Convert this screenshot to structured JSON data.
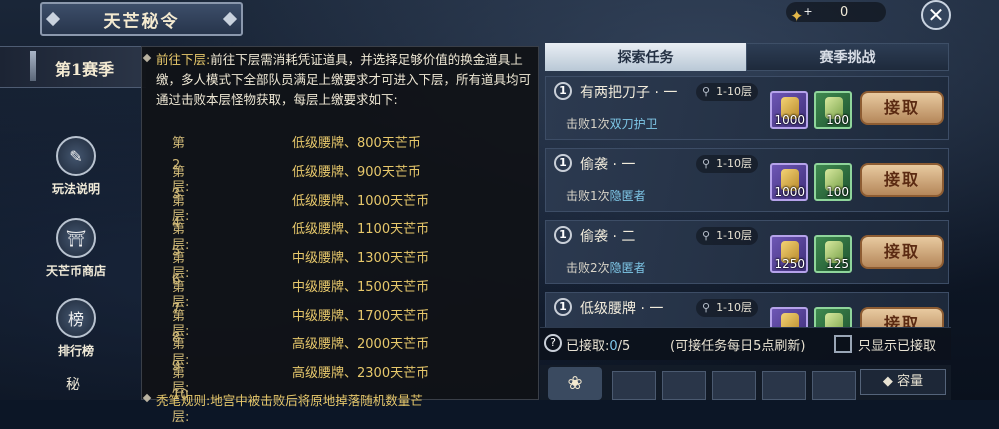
{
  "header": {
    "title": "天芒秘令",
    "currency_value": "0",
    "currency_plus": "+",
    "close_glyph": "✕"
  },
  "sidebar": {
    "season_label": "第1赛季",
    "buttons": [
      {
        "label": "玩法说明",
        "icon": "scroll-icon"
      },
      {
        "label": "天芒币商店",
        "icon": "shop-icon"
      },
      {
        "label": "排行榜",
        "icon": "ranking-icon",
        "glyph": "榜"
      }
    ],
    "partial_label": "秘"
  },
  "tooltip": {
    "intro_prefix": "前往下层:",
    "intro_text": "前往下层需消耗凭证道具，并选择足够价值的换金道具上缴，多人模式下全部队员满足上缴要求才可进入下层，所有道具均可通过击败本层怪物获取，每层上缴要求如下:",
    "floors": [
      {
        "floor": "第2层:",
        "req": "低级腰牌、800天芒币"
      },
      {
        "floor": "第3层:",
        "req": "低级腰牌、900天芒币"
      },
      {
        "floor": "第4层:",
        "req": "低级腰牌、1000天芒币"
      },
      {
        "floor": "第5层:",
        "req": "低级腰牌、1100天芒币"
      },
      {
        "floor": "第6层:",
        "req": "中级腰牌、1300天芒币"
      },
      {
        "floor": "第7层:",
        "req": "中级腰牌、1500天芒币"
      },
      {
        "floor": "第8层:",
        "req": "中级腰牌、1700天芒币"
      },
      {
        "floor": "第9层:",
        "req": "高级腰牌、2000天芒币"
      },
      {
        "floor": "第10层:",
        "req": "高级腰牌、2300天芒币"
      }
    ],
    "rule_text": "秃笔规则:地宫中被击败后将原地掉落随机数量芒"
  },
  "tabs": [
    {
      "label": "探索任务",
      "active": true
    },
    {
      "label": "赛季挑战",
      "active": false
    }
  ],
  "tasks": [
    {
      "num": "1",
      "name": "有两把刀子 · 一",
      "level": "1-10层",
      "goal_prefix": "击败1次",
      "goal_target": "双刀护卫",
      "reward1": "1000",
      "reward2": "100",
      "accept": "接取"
    },
    {
      "num": "1",
      "name": "偷袭 · 一",
      "level": "1-10层",
      "goal_prefix": "击败1次",
      "goal_target": "隐匿者",
      "reward1": "1000",
      "reward2": "100",
      "accept": "接取"
    },
    {
      "num": "1",
      "name": "偷袭 · 二",
      "level": "1-10层",
      "goal_prefix": "击败2次",
      "goal_target": "隐匿者",
      "reward1": "1250",
      "reward2": "125",
      "accept": "接取"
    },
    {
      "num": "1",
      "name": "低级腰牌 · 一",
      "level": "1-10层",
      "goal_prefix": "",
      "goal_target": "",
      "reward1": "",
      "reward2": "",
      "accept": "接取"
    }
  ],
  "footer": {
    "help_glyph": "?",
    "accepted_label": "已接取:",
    "accepted_count": "0",
    "accepted_total": "/5",
    "note": "(可接任务每日5点刷新)",
    "only_show_label": "只显示已接取"
  },
  "bag": {
    "capacity_label": "容量",
    "capacity_prefix": "◆"
  }
}
